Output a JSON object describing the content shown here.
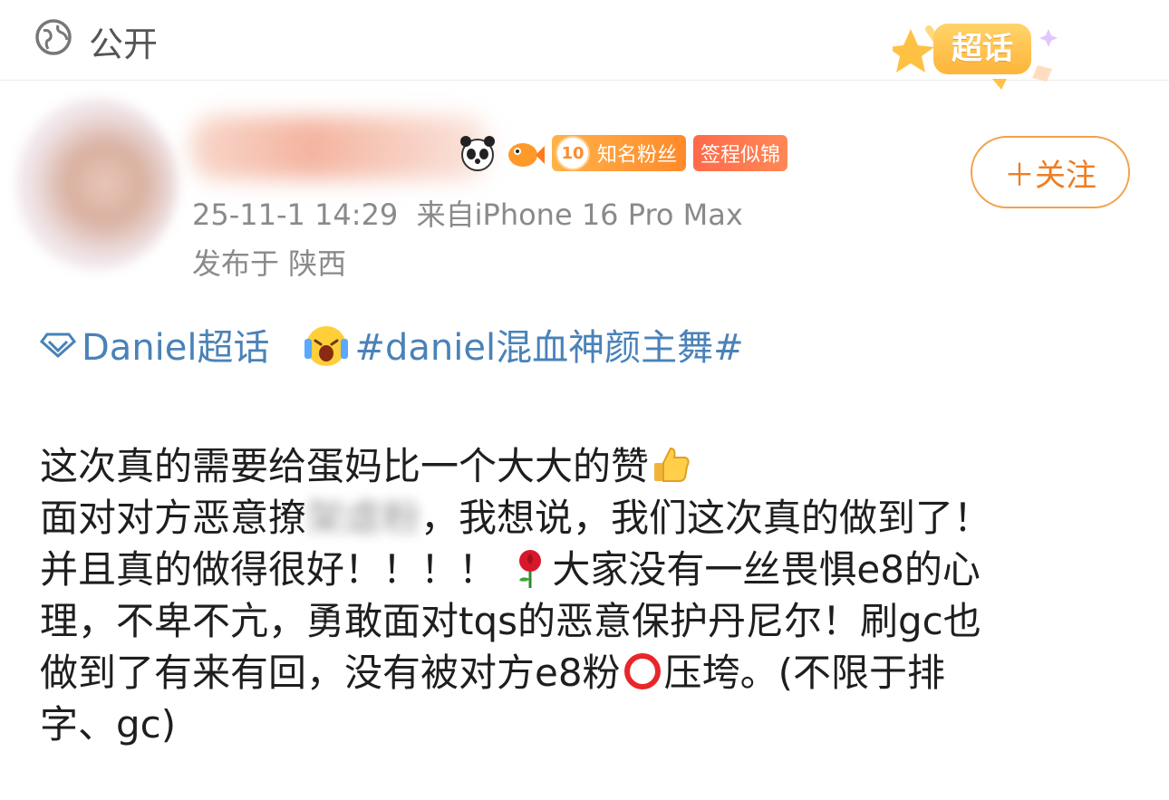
{
  "header": {
    "visibility_label": "公开",
    "visibility_icon": "globe-icon",
    "chaohua_badge": "超话"
  },
  "author": {
    "badges": {
      "fan_level": "10",
      "fan_label": "知名粉丝",
      "sign_label": "签程似锦"
    },
    "follow_label": "＋关注",
    "timestamp": "25-11-1 14:29",
    "source": "来自iPhone 16 Pro Max",
    "location": "发布于 陕西"
  },
  "topics": {
    "chaohua_link": "Daniel超话",
    "hashtag": "#daniel混血神颜主舞#"
  },
  "post": {
    "line1": "这次真的需要给蛋妈比一个大大的赞",
    "line2_a": "面对对方恶意撩",
    "line2_blur": "架虐粉",
    "line2_b": "，我想说，我们这次真的做到了！",
    "line3_a": "并且真的做得很好！！！！",
    "line3_b": "大家没有一丝畏惧e8的心",
    "line4": "理，不卑不亢，勇敢面对tqs的恶意保护丹尼尔！刷gc也",
    "line5_a": "做到了有来有回，没有被对方e8粉",
    "line5_b": "压垮。(不限于排",
    "line6": "字、gc)"
  },
  "colors": {
    "accent_orange": "#ef7d22",
    "link_blue": "#4a82b8",
    "meta_gray": "#8a8a8a"
  }
}
